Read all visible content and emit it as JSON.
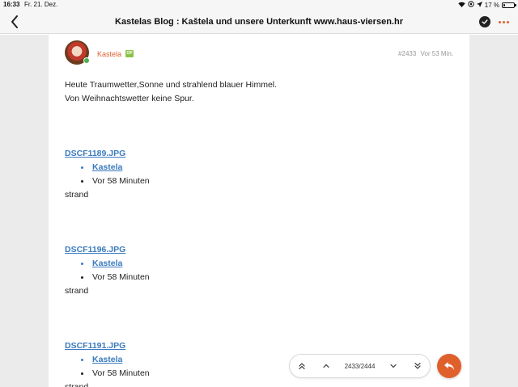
{
  "status_bar": {
    "time": "16:33",
    "date": "Fr. 21. Dez.",
    "battery": "17 %",
    "battery_level": 0.17
  },
  "header": {
    "title": "Kastelas Blog : Kaštela und unsere Unterkunft www.haus-viersen.hr"
  },
  "post": {
    "username": "Kastela",
    "badge": "OP",
    "post_number": "#2433",
    "post_time": "Vor 53 Min.",
    "body_lines": [
      "Heute Traumwetter,Sonne und strahlend blauer Himmel.",
      "Von Weihnachtswetter keine Spur."
    ],
    "attachments": [
      {
        "filename": "DSCF1189.JPG",
        "author": "Kastela",
        "time": "Vor 58 Minuten",
        "caption": "strand"
      },
      {
        "filename": "DSCF1196.JPG",
        "author": "Kastela",
        "time": "Vor 58 Minuten",
        "caption": "strand"
      },
      {
        "filename": "DSCF1191.JPG",
        "author": "Kastela",
        "time": "Vor 58 Minuten",
        "caption": "strand"
      }
    ]
  },
  "navigator": {
    "counter": "2433/2444"
  },
  "colors": {
    "accent": "#e0602c",
    "link": "#3a7abf",
    "online": "#4caf50"
  },
  "icons": {
    "back": "chevron-left-icon",
    "check": "check-circle-icon",
    "more": "more-dots-icon",
    "first": "double-chevron-up-icon",
    "prev": "chevron-up-icon",
    "next": "chevron-down-icon",
    "last": "double-chevron-down-icon",
    "reply": "reply-arrow-icon"
  }
}
